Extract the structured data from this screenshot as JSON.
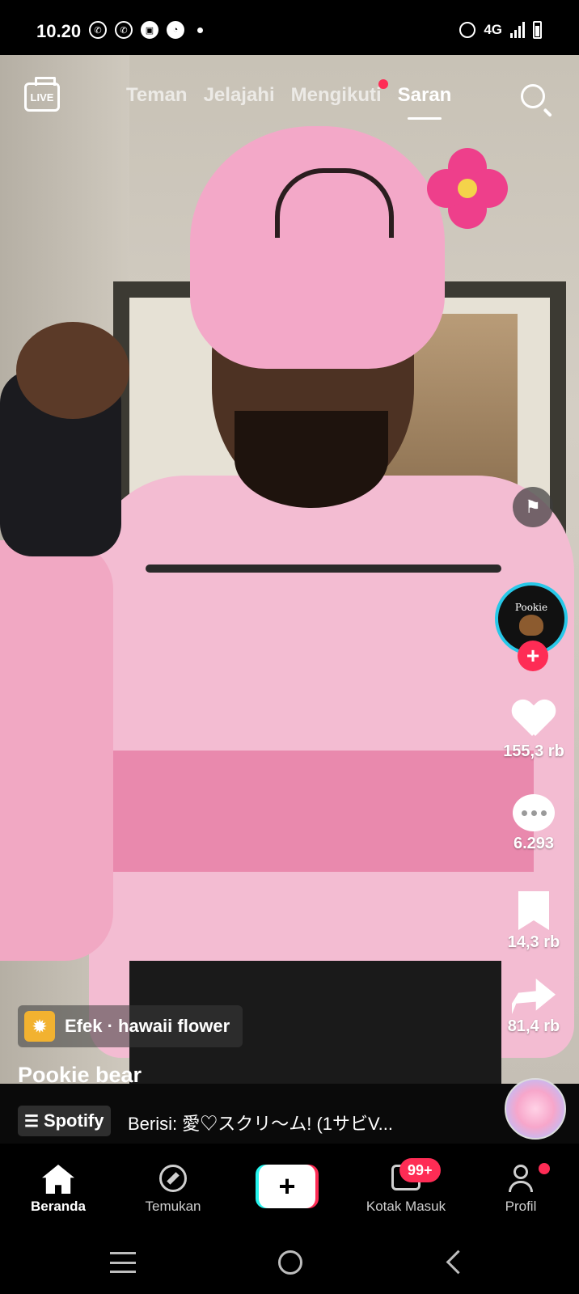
{
  "status_bar": {
    "time": "10.20",
    "network": "4G"
  },
  "top_nav": {
    "live_label": "LIVE",
    "tabs": [
      {
        "label": "Teman"
      },
      {
        "label": "Jelajahi"
      },
      {
        "label": "Mengikuti",
        "has_dot": true
      },
      {
        "label": "Saran",
        "active": true
      }
    ]
  },
  "video": {
    "effect": {
      "label": "Efek · hawaii flower"
    },
    "username": "Pookie bear"
  },
  "right_rail": {
    "avatar_text": "Pookie",
    "likes": "155,3 rb",
    "comments": "6.293",
    "saves": "14,3 rb",
    "shares": "81,4 rb"
  },
  "music": {
    "spotify_label": "Spotify",
    "track_text": "Berisi: 愛♡スクリ〜ム!  (1サビV..."
  },
  "bottom_nav": {
    "home": "Beranda",
    "discover": "Temukan",
    "create": "+",
    "inbox": "Kotak Masuk",
    "inbox_badge": "99+",
    "profile": "Profil"
  },
  "colors": {
    "accent": "#fe2c55",
    "cyan": "#25f4ee",
    "background": "#000000"
  }
}
